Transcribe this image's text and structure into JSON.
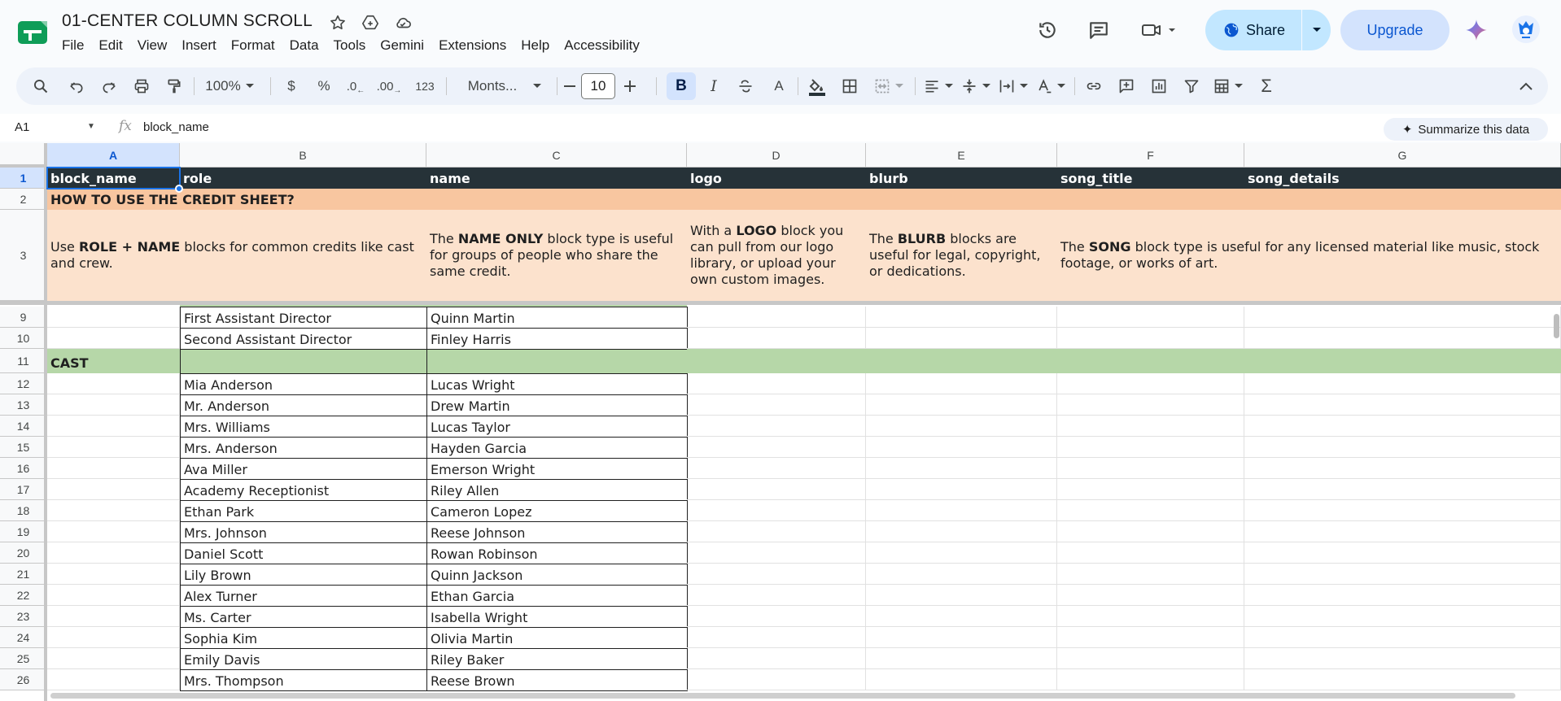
{
  "doc": {
    "title": "01-CENTER COLUMN SCROLL"
  },
  "menu": [
    "File",
    "Edit",
    "View",
    "Insert",
    "Format",
    "Data",
    "Tools",
    "Gemini",
    "Extensions",
    "Help",
    "Accessibility"
  ],
  "header": {
    "share_label": "Share",
    "upgrade_label": "Upgrade"
  },
  "toolbar": {
    "zoom": "100%",
    "currency": "$",
    "percent": "%",
    "dec_decrease": ".0",
    "dec_increase": ".00",
    "number_format": "123",
    "font": "Monts...",
    "font_size": "10",
    "bold": "B",
    "italic": "I",
    "text_color": "A"
  },
  "formula": {
    "cell_ref": "A1",
    "fx": "fx",
    "content": "block_name",
    "summarize": "Summarize this data"
  },
  "grid": {
    "columns": [
      "A",
      "B",
      "C",
      "D",
      "E",
      "F",
      "G"
    ],
    "header_row": {
      "row": "1",
      "cells": [
        "block_name",
        "role",
        "name",
        "logo",
        "blurb",
        "song_title",
        "song_details"
      ]
    },
    "howto_row": {
      "row": "2",
      "text": "HOW TO USE THE CREDIT SHEET?"
    },
    "desc_row": {
      "row": "3",
      "rolename": {
        "pre": "Use ",
        "bold": "ROLE + NAME",
        "post": " blocks for common credits like cast and crew."
      },
      "nameonly": {
        "pre": "The ",
        "bold": "NAME ONLY",
        "post": " block type is useful for groups of people who share the same credit."
      },
      "logo": {
        "pre": "With a ",
        "bold": "LOGO",
        "post": " block you can pull from our logo library, or upload your own custom images."
      },
      "blurb": {
        "pre": "The ",
        "bold": "BLURB",
        "post": " blocks are useful for legal, copyright, or dedications."
      },
      "song": {
        "pre": "The ",
        "bold": "SONG",
        "post": " block type is useful for any licensed material like music, stock footage, or works of art."
      }
    },
    "rows": [
      {
        "num": "9",
        "a": "",
        "role": "First Assistant Director",
        "name": "Quinn Martin"
      },
      {
        "num": "10",
        "a": "",
        "role": "Second Assistant Director",
        "name": "Finley Harris"
      },
      {
        "num": "11",
        "a": "CAST",
        "role": "",
        "name": "",
        "section": true
      },
      {
        "num": "12",
        "a": "",
        "role": "Mia Anderson",
        "name": "Lucas Wright"
      },
      {
        "num": "13",
        "a": "",
        "role": "Mr. Anderson",
        "name": "Drew Martin"
      },
      {
        "num": "14",
        "a": "",
        "role": "Mrs. Williams",
        "name": "Lucas Taylor"
      },
      {
        "num": "15",
        "a": "",
        "role": "Mrs. Anderson",
        "name": "Hayden Garcia"
      },
      {
        "num": "16",
        "a": "",
        "role": "Ava Miller",
        "name": "Emerson Wright"
      },
      {
        "num": "17",
        "a": "",
        "role": "Academy Receptionist",
        "name": "Riley Allen"
      },
      {
        "num": "18",
        "a": "",
        "role": "Ethan Park",
        "name": "Cameron Lopez"
      },
      {
        "num": "19",
        "a": "",
        "role": "Mrs. Johnson",
        "name": "Reese Johnson"
      },
      {
        "num": "20",
        "a": "",
        "role": "Daniel Scott",
        "name": "Rowan Robinson"
      },
      {
        "num": "21",
        "a": "",
        "role": "Lily Brown",
        "name": "Quinn Jackson"
      },
      {
        "num": "22",
        "a": "",
        "role": "Alex Turner",
        "name": "Ethan Garcia"
      },
      {
        "num": "23",
        "a": "",
        "role": "Ms. Carter",
        "name": "Isabella Wright"
      },
      {
        "num": "24",
        "a": "",
        "role": "Sophia Kim",
        "name": "Olivia Martin"
      },
      {
        "num": "25",
        "a": "",
        "role": "Emily Davis",
        "name": "Riley Baker"
      },
      {
        "num": "26",
        "a": "",
        "role": "Mrs. Thompson",
        "name": "Reese Brown"
      }
    ]
  },
  "colors": {
    "header_dark": "#263238",
    "howto": "#f8c6a0",
    "desc": "#fce2cd",
    "cast": "#b6d7a8",
    "accent": "#1a73e8"
  }
}
